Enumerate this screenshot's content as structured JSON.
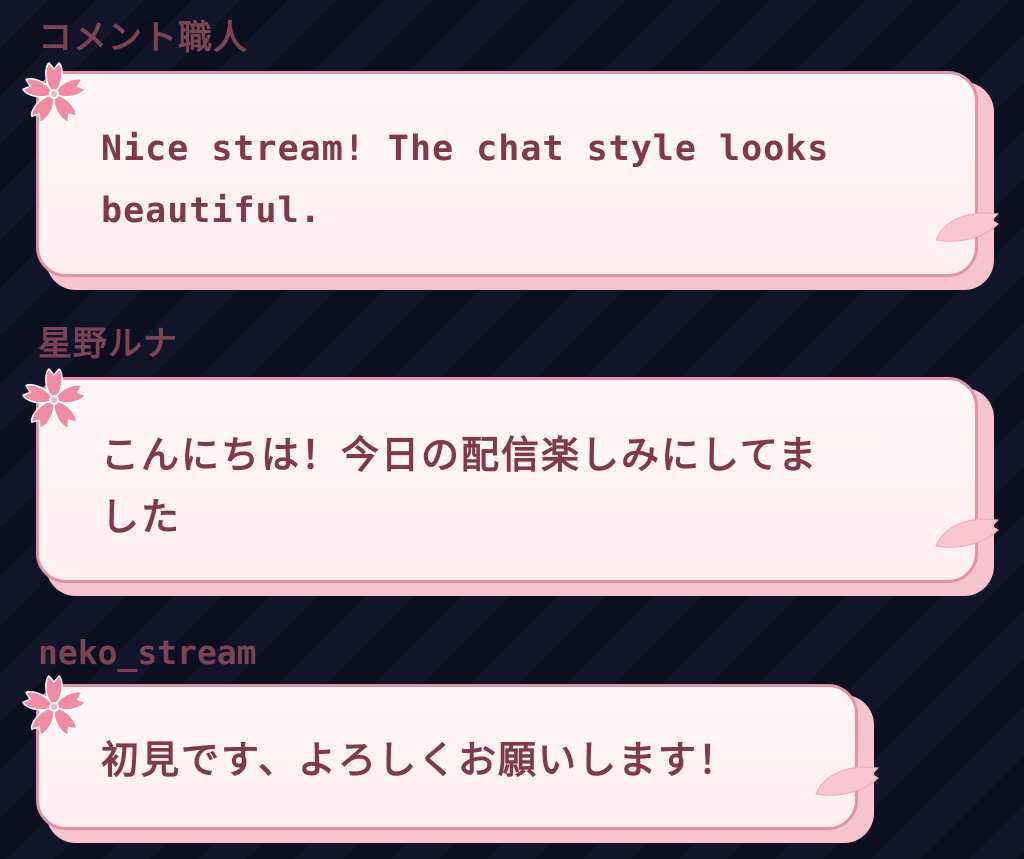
{
  "chat": {
    "messages": [
      {
        "author": "コメント職人",
        "text_lines": [
          "Nice stream! The chat style looks",
          "beautiful."
        ]
      },
      {
        "author": "星野ルナ",
        "text_lines": [
          "こんにちは！今日の配信楽しみにしてま",
          "した"
        ]
      },
      {
        "author": "neko_stream",
        "text_lines": [
          "初見です、よろしくお願いします！"
        ]
      }
    ]
  },
  "icons": {
    "sakura": "cherry-blossom-icon",
    "petal": "sakura-petal-icon"
  },
  "colors": {
    "background": "#0f1224",
    "author": "#7a4453",
    "bubble_border": "#e291a6",
    "bubble_fill": "#fff6f8",
    "text": "#7e3a4b",
    "blossom": "#ef8ca4"
  }
}
